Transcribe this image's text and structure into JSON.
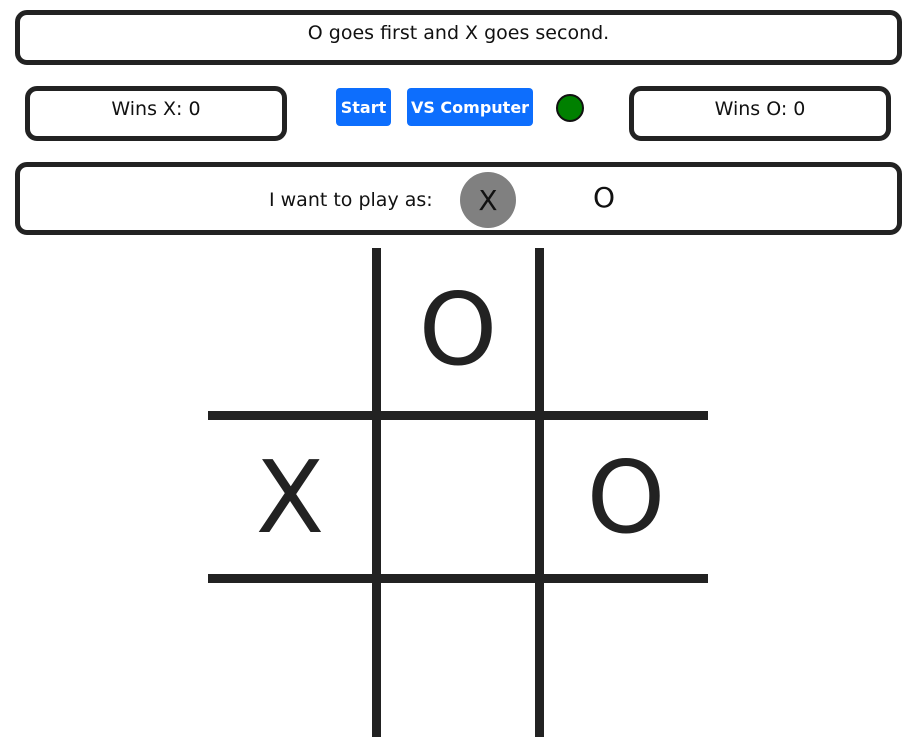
{
  "message": "O goes first and X goes second.",
  "scores": {
    "x_label": "Wins X: 0",
    "o_label": "Wins O: 0"
  },
  "controls": {
    "start_label": "Start",
    "vs_computer_label": "VS Computer",
    "status_color": "#008000"
  },
  "player_choice": {
    "label": "I want to play as:",
    "options": [
      "X",
      "O"
    ],
    "selected": "X",
    "selected_color": "#808080"
  },
  "board": {
    "cells": [
      "",
      "O",
      "",
      "X",
      "",
      "O",
      "",
      "",
      ""
    ]
  }
}
